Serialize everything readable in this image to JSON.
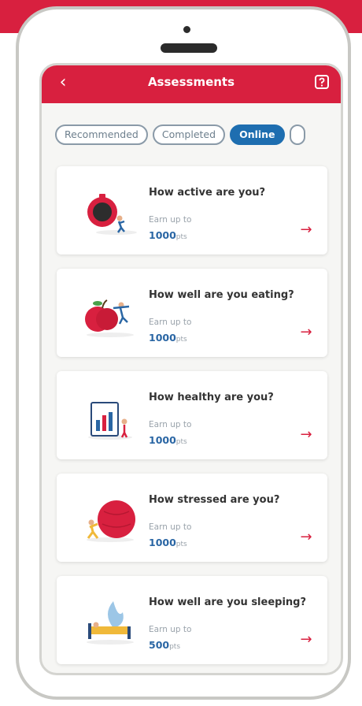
{
  "header": {
    "title": "Assessments",
    "back_icon": "chevron-left-icon",
    "help_icon": "help-icon"
  },
  "tabs": [
    {
      "label": "Recommended",
      "active": false
    },
    {
      "label": "Completed",
      "active": false
    },
    {
      "label": "Online",
      "active": true
    },
    {
      "label": "",
      "active": false
    }
  ],
  "assessments": [
    {
      "title": "How active are you?",
      "earn_label": "Earn up to",
      "points": "1000",
      "unit": "pts",
      "illustration": "stopwatch-runner-icon"
    },
    {
      "title": "How well are you eating?",
      "earn_label": "Earn up to",
      "points": "1000",
      "unit": "pts",
      "illustration": "apple-icon"
    },
    {
      "title": "How healthy are you?",
      "earn_label": "Earn up to",
      "points": "1000",
      "unit": "pts",
      "illustration": "health-chart-icon"
    },
    {
      "title": "How stressed are you?",
      "earn_label": "Earn up to",
      "points": "1000",
      "unit": "pts",
      "illustration": "stress-ball-icon"
    },
    {
      "title": "How well are you sleeping?",
      "earn_label": "Earn up to",
      "points": "500",
      "unit": "pts",
      "illustration": "bed-moon-icon"
    }
  ],
  "colors": {
    "brand_red": "#d8203f",
    "active_tab_blue": "#1e6eb0",
    "points_blue": "#2a66a4"
  }
}
